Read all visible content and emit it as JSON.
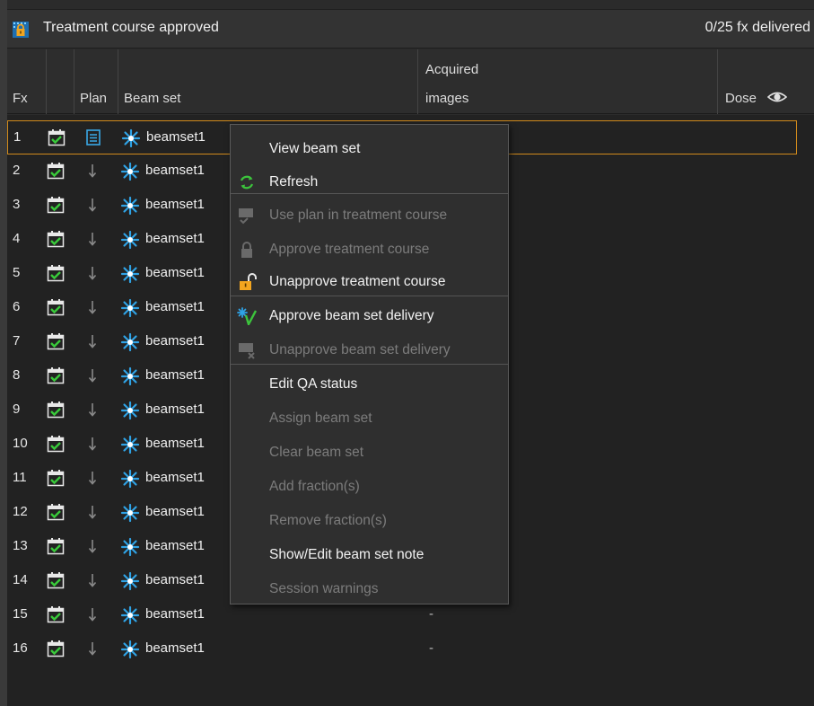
{
  "header": {
    "title": "Treatment course approved",
    "delivered": "0/25 fx delivered"
  },
  "columns": {
    "fx": "Fx",
    "plan": "Plan",
    "beam_set": "Beam set",
    "acquired_line1": "Acquired",
    "acquired_line2": "images",
    "dose": "Dose"
  },
  "rows": [
    {
      "fx": "1",
      "beam": "beamset1",
      "acq": "",
      "plan_icon": "plan-document-icon"
    },
    {
      "fx": "2",
      "beam": "beamset1",
      "acq": "",
      "plan_icon": "arrow-down-icon"
    },
    {
      "fx": "3",
      "beam": "beamset1",
      "acq": "",
      "plan_icon": "arrow-down-icon"
    },
    {
      "fx": "4",
      "beam": "beamset1",
      "acq": "",
      "plan_icon": "arrow-down-icon"
    },
    {
      "fx": "5",
      "beam": "beamset1",
      "acq": "",
      "plan_icon": "arrow-down-icon"
    },
    {
      "fx": "6",
      "beam": "beamset1",
      "acq": "",
      "plan_icon": "arrow-down-icon"
    },
    {
      "fx": "7",
      "beam": "beamset1",
      "acq": "",
      "plan_icon": "arrow-down-icon"
    },
    {
      "fx": "8",
      "beam": "beamset1",
      "acq": "",
      "plan_icon": "arrow-down-icon"
    },
    {
      "fx": "9",
      "beam": "beamset1",
      "acq": "",
      "plan_icon": "arrow-down-icon"
    },
    {
      "fx": "10",
      "beam": "beamset1",
      "acq": "",
      "plan_icon": "arrow-down-icon"
    },
    {
      "fx": "11",
      "beam": "beamset1",
      "acq": "",
      "plan_icon": "arrow-down-icon"
    },
    {
      "fx": "12",
      "beam": "beamset1",
      "acq": "",
      "plan_icon": "arrow-down-icon"
    },
    {
      "fx": "13",
      "beam": "beamset1",
      "acq": "",
      "plan_icon": "arrow-down-icon"
    },
    {
      "fx": "14",
      "beam": "beamset1",
      "acq": "-",
      "plan_icon": "arrow-down-icon"
    },
    {
      "fx": "15",
      "beam": "beamset1",
      "acq": "-",
      "plan_icon": "arrow-down-icon"
    },
    {
      "fx": "16",
      "beam": "beamset1",
      "acq": "-",
      "plan_icon": "arrow-down-icon"
    }
  ],
  "context_menu": {
    "items": [
      {
        "label": "View beam set",
        "enabled": true,
        "icon": ""
      },
      {
        "label": "Refresh",
        "enabled": true,
        "icon": "refresh-icon"
      },
      {
        "label": "Use plan in treatment course",
        "enabled": false,
        "icon": "use-plan-icon"
      },
      {
        "label": "Approve treatment course",
        "enabled": false,
        "icon": "lock-icon"
      },
      {
        "label": "Unapprove treatment course",
        "enabled": true,
        "icon": "unlock-icon"
      },
      {
        "label": "Approve beam set delivery",
        "enabled": true,
        "icon": "approve-delivery-icon"
      },
      {
        "label": "Unapprove beam set delivery",
        "enabled": false,
        "icon": "unapprove-delivery-icon"
      },
      {
        "label": "Edit QA status",
        "enabled": true,
        "icon": ""
      },
      {
        "label": "Assign beam set",
        "enabled": false,
        "icon": ""
      },
      {
        "label": "Clear beam set",
        "enabled": false,
        "icon": ""
      },
      {
        "label": "Add fraction(s)",
        "enabled": false,
        "icon": ""
      },
      {
        "label": "Remove fraction(s)",
        "enabled": false,
        "icon": ""
      },
      {
        "label": "Show/Edit beam set note",
        "enabled": true,
        "icon": ""
      },
      {
        "label": "Session warnings",
        "enabled": false,
        "icon": ""
      }
    ]
  },
  "colors": {
    "selection_border": "#d08a1c",
    "beam_icon": "#2fa3e6",
    "calendar_check": "#39c93a",
    "plan_doc": "#3aa9e8",
    "lock_orange": "#f2a51f"
  }
}
